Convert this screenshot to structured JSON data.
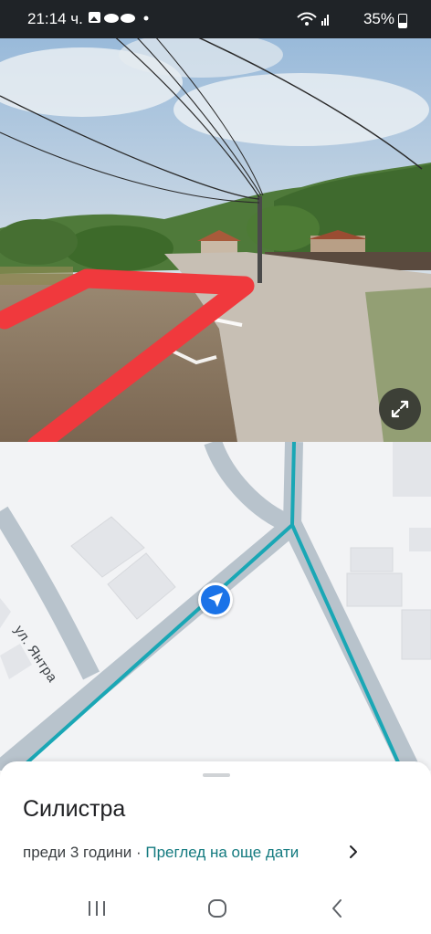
{
  "status_bar": {
    "time": "21:14 ч.",
    "battery": "35%"
  },
  "street_view": {
    "expand_icon": "expand-icon"
  },
  "map": {
    "street_label": "ул. Янтра",
    "route_color": "#1aa7b5",
    "marker_color": "#1a73e8"
  },
  "bottom_sheet": {
    "title": "Силистра",
    "age_text": "преди 3 години",
    "separator": " · ",
    "more_dates_link": "Преглед на още дати",
    "link_color": "#137a7f"
  },
  "nav_bar": {
    "recents_icon": "recents-icon",
    "home_icon": "home-icon",
    "back_icon": "back-icon"
  }
}
